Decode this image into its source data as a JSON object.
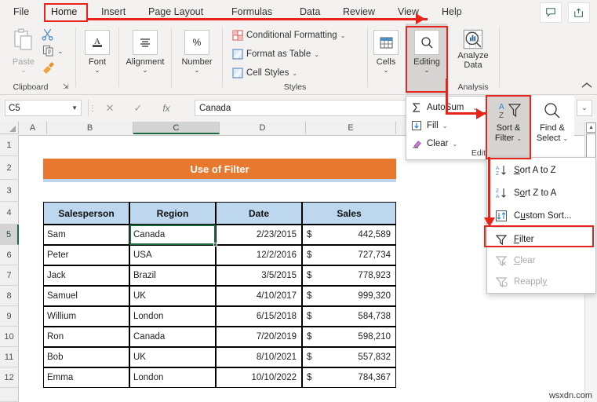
{
  "ribbon": {
    "tabs": [
      {
        "label": "File",
        "active": false
      },
      {
        "label": "Home",
        "active": true
      },
      {
        "label": "Insert",
        "active": false
      },
      {
        "label": "Page Layout",
        "active": false
      },
      {
        "label": "Formulas",
        "active": false
      },
      {
        "label": "Data",
        "active": false
      },
      {
        "label": "Review",
        "active": false
      },
      {
        "label": "View",
        "active": false
      },
      {
        "label": "Help",
        "active": false
      }
    ],
    "top_buttons": [
      {
        "name": "comments-button",
        "icon": "comment-icon"
      },
      {
        "name": "share-button",
        "icon": "share-icon"
      }
    ],
    "groups": {
      "clipboard": {
        "label": "Clipboard",
        "paste_label": "Paste",
        "cut_icon": "scissors-icon",
        "copy_icon": "copy-icon",
        "format_painter_icon": "paintbrush-icon",
        "dialog_launcher": "dialog-launcher-icon"
      },
      "font": {
        "label": "Font",
        "icon": "font-A-icon"
      },
      "alignment": {
        "label": "Alignment",
        "icon": "align-lines-icon"
      },
      "number": {
        "label": "Number",
        "icon": "percent-icon"
      },
      "styles": {
        "label": "Styles",
        "items": [
          {
            "label": "Conditional Formatting",
            "icon": "conditional-formatting-icon"
          },
          {
            "label": "Format as Table",
            "icon": "format-as-table-icon"
          },
          {
            "label": "Cell Styles",
            "icon": "cell-styles-icon"
          }
        ]
      },
      "cells": {
        "label": "Cells",
        "icon": "cells-icon"
      },
      "editing": {
        "label": "Editing",
        "icon": "magnifier-icon"
      },
      "analysis": {
        "label": "Analysis",
        "analyze_data_label": "Analyze Data",
        "icon": "analyze-data-icon"
      }
    },
    "collapse_icon": "chevron-up-icon"
  },
  "formula_bar": {
    "name_box_value": "C5",
    "name_box_caret": "dropdown-caret-icon",
    "cancel_icon": "cancel-x-icon",
    "enter_icon": "check-icon",
    "function_icon": "fx-icon",
    "value": "Canada",
    "expand_icon": "expand-caret-icon"
  },
  "editing_panel": {
    "items": [
      {
        "label": "AutoSum",
        "icon": "sigma-icon",
        "has_caret": true
      },
      {
        "label": "Fill",
        "icon": "fill-down-icon",
        "has_caret": true
      },
      {
        "label": "Clear",
        "icon": "eraser-icon",
        "has_caret": true
      }
    ],
    "group_label": "Editing",
    "sort_filter": {
      "line1": "Sort &",
      "line2": "Filter",
      "icon": "sort-filter-icon",
      "caret": "caret-down"
    },
    "find_select": {
      "line1": "Find &",
      "line2": "Select",
      "icon": "magnifier-icon",
      "caret": "caret-down"
    }
  },
  "sort_filter_menu": {
    "items": [
      {
        "label": "Sort A to Z",
        "icon": "sort-az-icon",
        "disabled": false,
        "highlighted": false
      },
      {
        "label": "Sort Z to A",
        "icon": "sort-za-icon",
        "disabled": false,
        "highlighted": false
      },
      {
        "label": "Custom Sort...",
        "icon": "custom-sort-icon",
        "disabled": false,
        "highlighted": false
      },
      {
        "label": "Filter",
        "icon": "funnel-icon",
        "disabled": false,
        "highlighted": true
      },
      {
        "label": "Clear",
        "icon": "clear-filter-icon",
        "disabled": true,
        "highlighted": false
      },
      {
        "label": "Reapply",
        "icon": "reapply-filter-icon",
        "disabled": true,
        "highlighted": false
      }
    ]
  },
  "sheet": {
    "column_headers": [
      "A",
      "B",
      "C",
      "D",
      "E"
    ],
    "selected_column": "C",
    "row_headers": [
      "1",
      "2",
      "3",
      "4",
      "5",
      "6",
      "7",
      "8",
      "9",
      "10",
      "11",
      "12"
    ],
    "selected_row": "5",
    "banner_title": "Use of Filter",
    "table_headers": [
      "Salesperson",
      "Region",
      "Date",
      "Sales"
    ],
    "rows": [
      {
        "salesperson": "Sam",
        "region": "Canada",
        "date": "2/23/2015",
        "currency": "$",
        "sales": "442,589"
      },
      {
        "salesperson": "Peter",
        "region": "USA",
        "date": "12/2/2016",
        "currency": "$",
        "sales": "727,734"
      },
      {
        "salesperson": "Jack",
        "region": "Brazil",
        "date": "3/5/2015",
        "currency": "$",
        "sales": "778,923"
      },
      {
        "salesperson": "Samuel",
        "region": "UK",
        "date": "4/10/2017",
        "currency": "$",
        "sales": "999,320"
      },
      {
        "salesperson": "Willium",
        "region": "London",
        "date": "6/15/2018",
        "currency": "$",
        "sales": "584,738"
      },
      {
        "salesperson": "Ron",
        "region": "Canada",
        "date": "7/20/2019",
        "currency": "$",
        "sales": "598,210"
      },
      {
        "salesperson": "Bob",
        "region": "UK",
        "date": "8/10/2021",
        "currency": "$",
        "sales": "557,832"
      },
      {
        "salesperson": "Emma",
        "region": "London",
        "date": "10/10/2022",
        "currency": "$",
        "sales": "784,367"
      }
    ],
    "active_cell": "C5"
  },
  "colors": {
    "banner_orange": "#E8782E",
    "header_blue": "#BDD7EE",
    "annotation_red": "#E8231A",
    "selection_green": "#1C6B3F"
  },
  "watermark": "wsxdn.com"
}
